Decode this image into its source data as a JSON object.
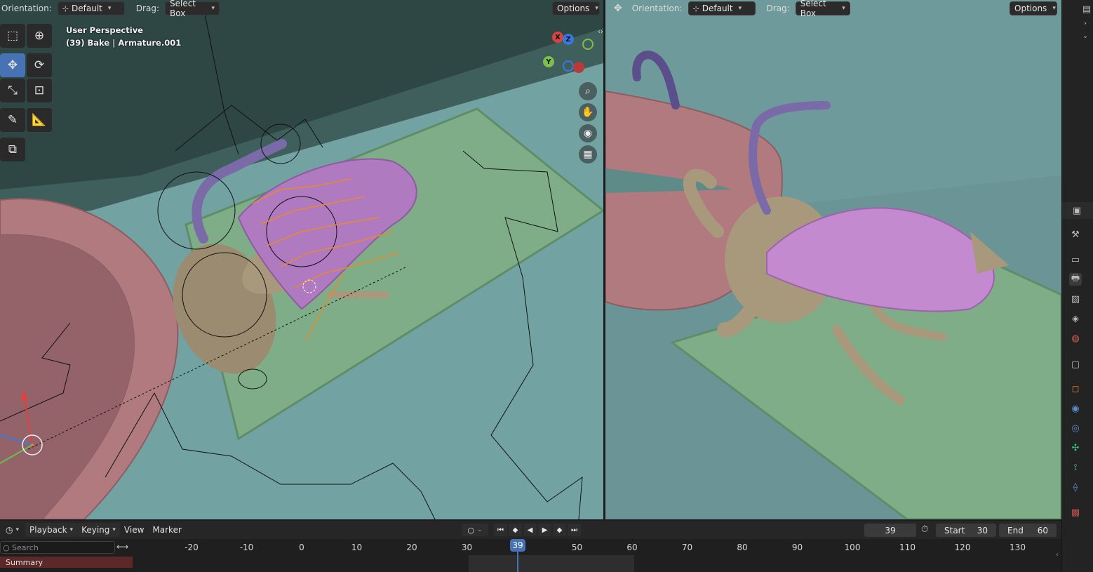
{
  "left_viewport": {
    "header": {
      "orientation_label": "Orientation:",
      "orientation_value": "Default",
      "drag_label": "Drag:",
      "drag_value": "Select Box",
      "options_label": "Options"
    },
    "view_name": "User Perspective",
    "view_subtitle": "(39) Bake | Armature.001",
    "gizmo": {
      "x": "X",
      "y": "Y",
      "z": "Z"
    },
    "nav_icons": [
      "zoom-icon",
      "hand-pan-icon",
      "camera-icon",
      "grid-ortho-icon"
    ],
    "tools": [
      "select-box-icon",
      "cursor-icon",
      "move-icon",
      "rotate-icon",
      "scale-icon",
      "transform-icon",
      "annotate-icon",
      "measure-icon",
      "add-cube-icon"
    ]
  },
  "right_viewport": {
    "header": {
      "orientation_label": "Orientation:",
      "orientation_value": "Default",
      "drag_label": "Drag:",
      "drag_value": "Select Box",
      "options_label": "Options"
    }
  },
  "timeline": {
    "menu": {
      "playback": "Playback",
      "keying": "Keying",
      "view": "View",
      "marker": "Marker"
    },
    "current_frame": "39",
    "start_label": "Start",
    "start_value": "30",
    "end_label": "End",
    "end_value": "60",
    "search_placeholder": "Search",
    "summary_label": "Summary",
    "ruler_ticks": [
      "-20",
      "-10",
      "0",
      "10",
      "20",
      "30",
      "40",
      "50",
      "60",
      "70",
      "80",
      "90",
      "100",
      "110",
      "120",
      "130"
    ],
    "playhead_label": "39"
  },
  "properties_icons": [
    "tool-icon",
    "render-icon",
    "output-icon",
    "view-layer-icon",
    "scene-icon",
    "world-icon",
    "collection-icon",
    "object-icon",
    "modifier-icon",
    "particles-icon",
    "physics-icon",
    "constraints-icon",
    "data-icon",
    "texture-icon"
  ],
  "colors": {
    "viewport_bg": "#6f9a9c",
    "accent": "#4772b3",
    "header_bg": "#262626"
  }
}
